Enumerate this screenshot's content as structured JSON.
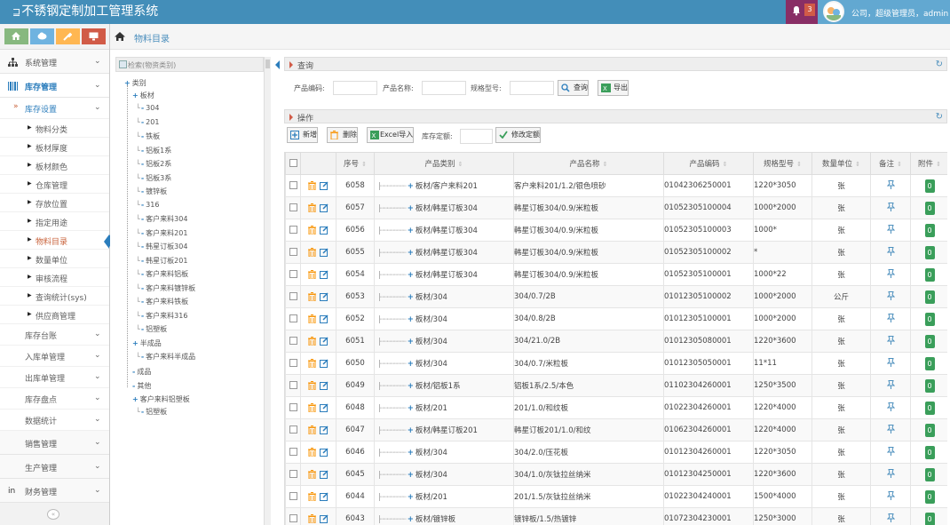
{
  "header": {
    "title": "不锈钢定制加工管理系统",
    "logo_glyph": "⊒",
    "notification_count": "3",
    "user_text": "公司，超级管理员，admin"
  },
  "colors": {
    "topbar": "#438eb9",
    "bell_bg": "#892e65",
    "user_bg": "#62a8d1",
    "accent": "#2b7dbc",
    "green": "#3a9e5a",
    "orange": "#f89406",
    "red": "#d15b47"
  },
  "shortcuts": [
    {
      "icon": "signal-icon",
      "color": "#87b87f"
    },
    {
      "icon": "cloud-icon",
      "color": "#6fb3e0"
    },
    {
      "icon": "wrench-icon",
      "color": "#ffb752"
    },
    {
      "icon": "monitor-icon",
      "color": "#d15b47"
    }
  ],
  "sidebar": {
    "menu": [
      {
        "label": "系统管理",
        "icon": "sitemap-icon"
      },
      {
        "label": "库存管理",
        "icon": "barcode-icon"
      }
    ],
    "inventory_settings": "库存设置",
    "settings_items": [
      "物料分类",
      "板材厚度",
      "板材颜色",
      "仓库管理",
      "存放位置",
      "指定用途",
      "物料目录",
      "数量单位",
      "审核流程",
      "查询统计(sys)",
      "供应商管理"
    ],
    "inventory_groups": [
      "库存台账",
      "入库单管理",
      "出库单管理",
      "库存盘点",
      "数据统计"
    ],
    "bottom_menu": [
      {
        "label": "销售管理",
        "icon": "briefcase-icon"
      },
      {
        "label": "生产管理",
        "icon": "gavel-icon"
      },
      {
        "label": "财务管理",
        "icon": "linkedin-icon"
      }
    ],
    "collapse_glyph": "«"
  },
  "breadcrumb": {
    "label": "物料目录"
  },
  "tree": {
    "search_label": "检索(物资类别)",
    "root": "类别",
    "board": "板材",
    "board_children": [
      "304",
      "201",
      "铁板",
      "铝板1系",
      "铝板2系",
      "铝板3系",
      "镀锌板",
      "316",
      "客户来料304",
      "客户来料201",
      "韩星订板304",
      "韩星订板201",
      "客户来料铝板",
      "客户来料镀锌板",
      "客户来料铁板",
      "客户来料316",
      "铝塑板"
    ],
    "semi": "半成品",
    "semi_children": [
      "客户来料半成品"
    ],
    "finished": "成品",
    "other": "其他",
    "customer_alu": "客户来料铝塑板",
    "customer_alu_children": [
      "铝塑板"
    ]
  },
  "query": {
    "title": "查询",
    "code_label": "产品编码:",
    "name_label": "产品名称:",
    "spec_label": "规格型号:",
    "search_btn": "查询",
    "export_btn": "导出"
  },
  "operations": {
    "title": "操作",
    "add_btn": "新增",
    "delete_btn": "删除",
    "import_btn": "Excel导入",
    "quota_label": "库存定额:",
    "modify_btn": "修改定额"
  },
  "table": {
    "headers": [
      "序号",
      "产品类别",
      "产品名称",
      "产品编码",
      "规格型号",
      "数量单位",
      "备注",
      "附件"
    ],
    "sort_glyph": "⇕",
    "attach_count": "0",
    "rows": [
      {
        "no": "6058",
        "cat": "板材/客户来料201",
        "name": "客户来料201/1.2/银色喷砂",
        "code": "01042306250001",
        "spec": "1220*3050",
        "unit": "张"
      },
      {
        "no": "6057",
        "cat": "板材/韩星订板304",
        "name": "韩星订板304/0.9/米粒板",
        "code": "01052305100004",
        "spec": "1000*2000",
        "unit": "张"
      },
      {
        "no": "6056",
        "cat": "板材/韩星订板304",
        "name": "韩星订板304/0.9/米粒板",
        "code": "01052305100003",
        "spec": "1000*",
        "unit": "张"
      },
      {
        "no": "6055",
        "cat": "板材/韩星订板304",
        "name": "韩星订板304/0.9/米粒板",
        "code": "01052305100002",
        "spec": "*",
        "unit": "张"
      },
      {
        "no": "6054",
        "cat": "板材/韩星订板304",
        "name": "韩星订板304/0.9/米粒板",
        "code": "01052305100001",
        "spec": "1000*22",
        "unit": "张"
      },
      {
        "no": "6053",
        "cat": "板材/304",
        "name": "304/0.7/2B",
        "code": "01012305100002",
        "spec": "1000*2000",
        "unit": "公斤"
      },
      {
        "no": "6052",
        "cat": "板材/304",
        "name": "304/0.8/2B",
        "code": "01012305100001",
        "spec": "1000*2000",
        "unit": "张"
      },
      {
        "no": "6051",
        "cat": "板材/304",
        "name": "304/21.0/2B",
        "code": "01012305080001",
        "spec": "1220*3600",
        "unit": "张"
      },
      {
        "no": "6050",
        "cat": "板材/304",
        "name": "304/0.7/米粒板",
        "code": "01012305050001",
        "spec": "11*11",
        "unit": "张"
      },
      {
        "no": "6049",
        "cat": "板材/铝板1系",
        "name": "铝板1系/2.5/本色",
        "code": "01102304260001",
        "spec": "1250*3500",
        "unit": "张"
      },
      {
        "no": "6048",
        "cat": "板材/201",
        "name": "201/1.0/和纹板",
        "code": "01022304260001",
        "spec": "1220*4000",
        "unit": "张"
      },
      {
        "no": "6047",
        "cat": "板材/韩星订板201",
        "name": "韩星订板201/1.0/和纹",
        "code": "01062304260001",
        "spec": "1220*4000",
        "unit": "张"
      },
      {
        "no": "6046",
        "cat": "板材/304",
        "name": "304/2.0/压花板",
        "code": "01012304260001",
        "spec": "1220*3050",
        "unit": "张"
      },
      {
        "no": "6045",
        "cat": "板材/304",
        "name": "304/1.0/灰钛拉丝纳米",
        "code": "01012304250001",
        "spec": "1220*3600",
        "unit": "张"
      },
      {
        "no": "6044",
        "cat": "板材/201",
        "name": "201/1.5/灰钛拉丝纳米",
        "code": "01022304240001",
        "spec": "1500*4000",
        "unit": "张"
      },
      {
        "no": "6043",
        "cat": "板材/镀锌板",
        "name": "镀锌板/1.5/热镀锌",
        "code": "01072304230001",
        "spec": "1250*3000",
        "unit": "张"
      }
    ]
  }
}
